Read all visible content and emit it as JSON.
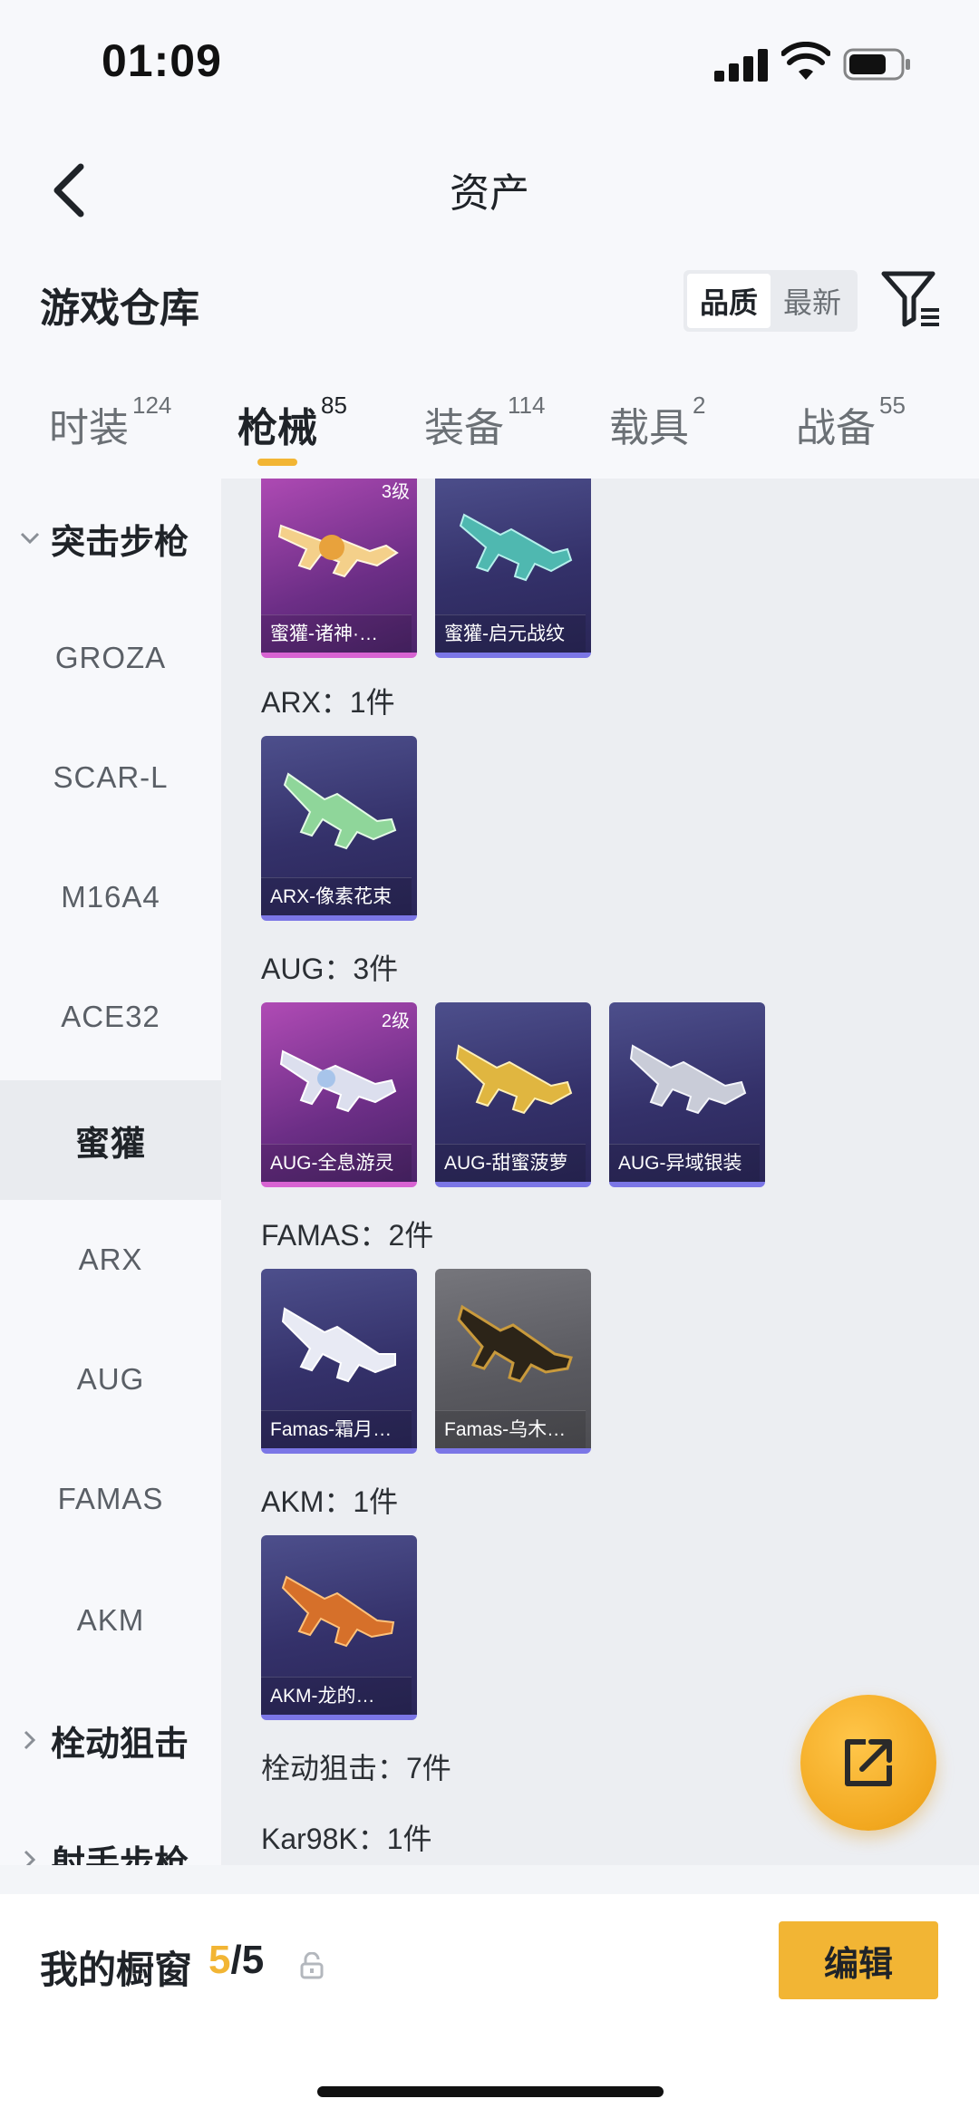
{
  "status_bar": {
    "time": "01:09"
  },
  "nav": {
    "title": "资产",
    "back_icon": "chevron-left-icon"
  },
  "warehouse": {
    "title": "游戏仓库",
    "sort_options": [
      "品质",
      "最新"
    ],
    "sort_selected": "品质",
    "filter_icon": "filter-icon"
  },
  "tabs": [
    {
      "label": "时装",
      "count": "124"
    },
    {
      "label": "枪械",
      "count": "85",
      "active": true
    },
    {
      "label": "装备",
      "count": "114"
    },
    {
      "label": "载具",
      "count": "2"
    },
    {
      "label": "战备",
      "count": "55"
    }
  ],
  "sidebar": {
    "categories": [
      {
        "label": "突击步枪",
        "expanded": true
      },
      {
        "label": "栓动狙击",
        "expanded": false
      },
      {
        "label": "射手步枪",
        "expanded": false
      }
    ],
    "items": [
      "GROZA",
      "SCAR-L",
      "M16A4",
      "ACE32",
      "蜜獾",
      "ARX",
      "AUG",
      "FAMAS",
      "AKM"
    ],
    "active_item": "蜜獾"
  },
  "groups": [
    {
      "label": "",
      "items": [
        {
          "name": "蜜獾-诸神·…",
          "level": "3级",
          "rarity": "purple"
        },
        {
          "name": "蜜獾-启元战纹",
          "level": "",
          "rarity": "blue"
        }
      ]
    },
    {
      "label": "ARX：1件",
      "items": [
        {
          "name": "ARX-像素花束",
          "level": "",
          "rarity": "blue"
        }
      ]
    },
    {
      "label": "AUG：3件",
      "items": [
        {
          "name": "AUG-全息游灵",
          "level": "2级",
          "rarity": "purple"
        },
        {
          "name": "AUG-甜蜜菠萝",
          "level": "",
          "rarity": "blue"
        },
        {
          "name": "AUG-异域银装",
          "level": "",
          "rarity": "blue"
        }
      ]
    },
    {
      "label": "FAMAS：2件",
      "items": [
        {
          "name": "Famas-霜月…",
          "level": "",
          "rarity": "blue"
        },
        {
          "name": "Famas-乌木…",
          "level": "",
          "rarity": "gray"
        }
      ]
    },
    {
      "label": "AKM：1件",
      "items": [
        {
          "name": "AKM-龙的…",
          "level": "",
          "rarity": "blue"
        }
      ]
    },
    {
      "label": "栓动狙击：7件",
      "items": []
    },
    {
      "label": "Kar98K：1件",
      "items": []
    }
  ],
  "fab": {
    "icon": "share-icon"
  },
  "bottom": {
    "showcase_label": "我的橱窗",
    "showcase_current": "5",
    "showcase_sep": "/",
    "showcase_total": "5",
    "lock_icon": "lock-icon",
    "edit_label": "编辑"
  },
  "colors": {
    "accent": "#f2b534",
    "purple_rarity": "#d763d2",
    "blue_rarity": "#7b76e6"
  }
}
